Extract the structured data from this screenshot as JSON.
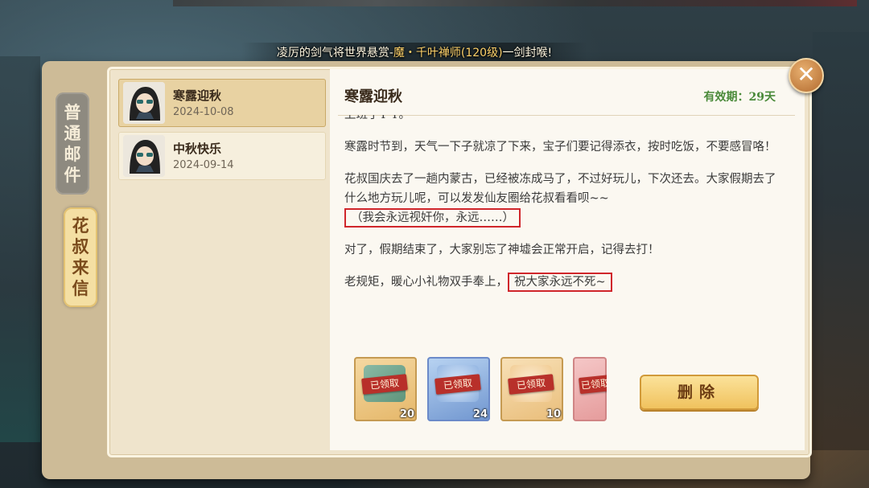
{
  "marquee": {
    "prefix": "凌厉的剑气将世界悬赏-",
    "highlight": "魔・千叶禅师(120级)",
    "suffix": "一剑封喉!"
  },
  "tabs": [
    {
      "label_chars": [
        "普",
        "通",
        "邮",
        "件"
      ],
      "active": false
    },
    {
      "label_chars": [
        "花",
        "叔",
        "来",
        "信"
      ],
      "active": true
    }
  ],
  "mails": [
    {
      "title": "寒露迎秋",
      "date": "2024-10-08",
      "selected": true
    },
    {
      "title": "中秋快乐",
      "date": "2024-09-14",
      "selected": false
    }
  ],
  "mail_detail": {
    "title": "寒露迎秋",
    "expiry": "有效期：29天",
    "paragraphs": {
      "p0_cut": "上班了T T。",
      "p1": "寒露时节到，天气一下子就凉了下来，宝子们要记得添衣，按时吃饭，不要感冒咯！",
      "p2": "花叔国庆去了一趟内蒙古，已经被冻成马了，不过好玩儿，下次还去。大家假期去了什么地方玩儿呢，可以发发仙友圈给花叔看看呗~~",
      "p2_boxed": "（我会永远视奸你，永远……）",
      "p3": "对了，假期结束了，大家别忘了神墟会正常开启，记得去打！",
      "p4": "老规矩，暖心小礼物双手奉上，",
      "p4_boxed": "祝大家永远不死~"
    },
    "rewards": [
      {
        "status": "已领取",
        "qty": "20",
        "icon": "ticket-item-icon"
      },
      {
        "status": "已领取",
        "qty": "24",
        "icon": "crystal-item-icon"
      },
      {
        "status": "已领取",
        "qty": "10",
        "icon": "lotus-item-icon"
      },
      {
        "status": "已领取",
        "qty": "",
        "icon": "gift-item-icon"
      }
    ],
    "delete_label": "删除"
  },
  "close_symbol": "✕",
  "colors": {
    "accent_gold": "#f0c25e",
    "claimed_red": "#b8302a",
    "expiry_green": "#4a8a3a",
    "highlight_box": "#d0262b"
  }
}
